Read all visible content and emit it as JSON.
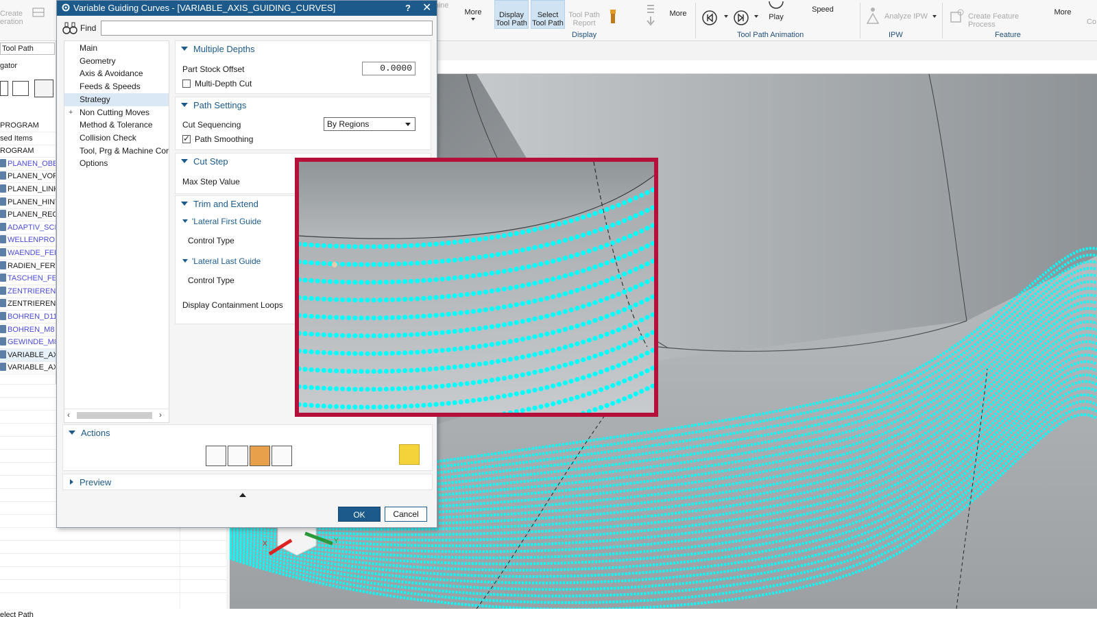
{
  "ribbon": {
    "create_operation_label": "Create\neration",
    "more1_label": "More",
    "display_tool_path_label": "Display\nTool Path",
    "select_tool_path_label": "Select\nTool Path",
    "tool_path_report_label": "Tool Path\nReport",
    "more2_label": "More",
    "play_label": "Play",
    "speed_label": "Speed",
    "analyze_ipw_label": "Analyze IPW",
    "create_feature_process_label": "Create Feature Process",
    "more3_label": "More",
    "partial_left_label": "nine",
    "partial_right_label": "Co",
    "group_display": "Display",
    "group_animation": "Tool Path Animation",
    "group_ipw": "IPW",
    "group_feature": "Feature"
  },
  "navigator": {
    "toolbar_label": "Tool Path",
    "title": "gator",
    "rows": [
      {
        "label": "PROGRAM",
        "style": "normal"
      },
      {
        "label": "sed Items",
        "style": "normal"
      },
      {
        "label": "ROGRAM",
        "style": "normal"
      },
      {
        "label": "PLANEN_OBEI",
        "style": "blue"
      },
      {
        "label": "PLANEN_VOR",
        "style": "normal"
      },
      {
        "label": "PLANEN_LINK",
        "style": "normal"
      },
      {
        "label": "PLANEN_HINT",
        "style": "normal"
      },
      {
        "label": "PLANEN_RECH",
        "style": "normal"
      },
      {
        "label": "ADAPTIV_SCH",
        "style": "blue"
      },
      {
        "label": "WELLENPROF",
        "style": "blue"
      },
      {
        "label": "WAENDE_FER'",
        "style": "blue"
      },
      {
        "label": "RADIEN_FERTI",
        "style": "normal"
      },
      {
        "label": "TASCHEN_FER",
        "style": "blue"
      },
      {
        "label": "ZENTRIEREN_[",
        "style": "blue"
      },
      {
        "label": "ZENTRIEREN_I",
        "style": "normal"
      },
      {
        "label": "BOHREN_D11",
        "style": "blue"
      },
      {
        "label": "BOHREN_M8",
        "style": "blue"
      },
      {
        "label": "GEWINDE_M8",
        "style": "blue"
      },
      {
        "label": "VARIABLE_AXI",
        "style": "selected"
      },
      {
        "label": "VARIABLE_AXI",
        "style": "normal"
      }
    ]
  },
  "status": {
    "text": "elect Path"
  },
  "dialog": {
    "title": "Variable Guiding Curves - [VARIABLE_AXIS_GUIDING_CURVES]",
    "help": "?",
    "close": "✕",
    "find_label": "Find",
    "find_value": "",
    "tree": [
      {
        "label": "Main",
        "selected": false,
        "expandable": false
      },
      {
        "label": "Geometry",
        "selected": false,
        "expandable": false
      },
      {
        "label": "Axis & Avoidance",
        "selected": false,
        "expandable": false
      },
      {
        "label": "Feeds & Speeds",
        "selected": false,
        "expandable": false
      },
      {
        "label": "Strategy",
        "selected": true,
        "expandable": false
      },
      {
        "label": "Non Cutting Moves",
        "selected": false,
        "expandable": true
      },
      {
        "label": "Method & Tolerance",
        "selected": false,
        "expandable": false
      },
      {
        "label": "Collision Check",
        "selected": false,
        "expandable": false
      },
      {
        "label": "Tool, Prg & Machine Contr",
        "selected": false,
        "expandable": false
      },
      {
        "label": "Options",
        "selected": false,
        "expandable": false
      }
    ],
    "multiple_depths": {
      "heading": "Multiple Depths",
      "part_stock_offset_label": "Part Stock Offset",
      "part_stock_offset_value": "0.0000",
      "multi_depth_cut_label": "Multi-Depth Cut",
      "multi_depth_cut_checked": false
    },
    "path_settings": {
      "heading": "Path Settings",
      "cut_sequencing_label": "Cut Sequencing",
      "cut_sequencing_value": "By Regions",
      "path_smoothing_label": "Path Smoothing",
      "path_smoothing_checked": true
    },
    "cut_step": {
      "heading": "Cut Step",
      "max_step_label": "Max Step Value"
    },
    "trim_extend": {
      "heading": "Trim and Extend",
      "lateral_first_heading": "'Lateral First Guide",
      "control_type_1": "Control Type",
      "lateral_last_heading": "'Lateral Last Guide",
      "control_type_2": "Control Type",
      "display_containment_label": "Display Containment Loops"
    },
    "actions_heading": "Actions",
    "preview_heading": "Preview",
    "ok_label": "OK",
    "cancel_label": "Cancel"
  },
  "viewport": {
    "axis_x": "X",
    "axis_y": "Y"
  },
  "colors": {
    "title_bar": "#1b5a8a",
    "toolpath": "#00ffff",
    "zoom_frame": "#b5103a",
    "generate_button": "#f3d23a"
  }
}
